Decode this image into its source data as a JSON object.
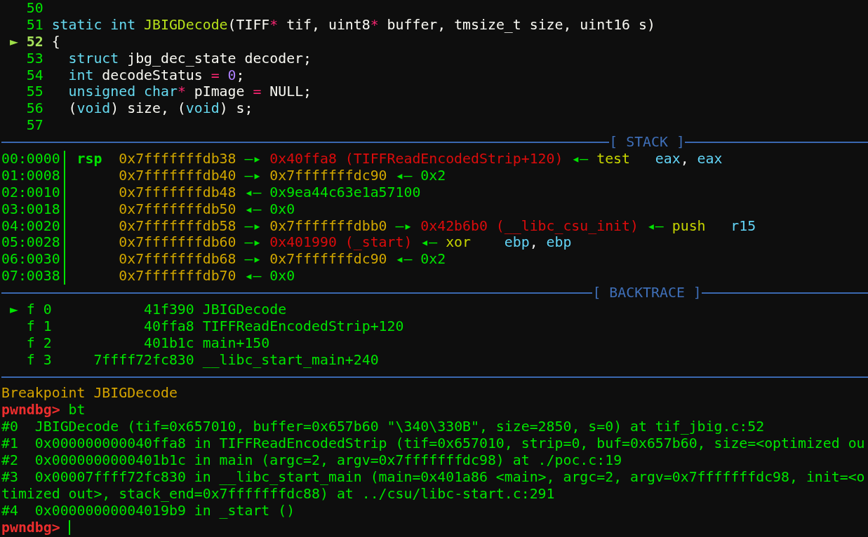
{
  "source": {
    "marker": "►",
    "lines": [
      {
        "number": "50",
        "current": false
      },
      {
        "number": "51",
        "current": false,
        "code": [
          {
            "kind": "keyword",
            "text": "static int "
          },
          {
            "kind": "function",
            "text": "JBIGDecode"
          },
          {
            "kind": "plain",
            "text": "(TIFF"
          },
          {
            "kind": "operator",
            "text": "*"
          },
          {
            "kind": "plain",
            "text": " tif, uint8"
          },
          {
            "kind": "operator",
            "text": "*"
          },
          {
            "kind": "plain",
            "text": " buffer, tmsize_t size, uint16 s)"
          }
        ]
      },
      {
        "number": "52",
        "current": true,
        "code": [
          {
            "kind": "plain",
            "text": "{"
          }
        ]
      },
      {
        "number": "53",
        "current": false,
        "code": [
          {
            "kind": "keyword",
            "text": "  struct"
          },
          {
            "kind": "plain",
            "text": " jbg_dec_state decoder;"
          }
        ]
      },
      {
        "number": "54",
        "current": false,
        "code": [
          {
            "kind": "keyword",
            "text": "  int"
          },
          {
            "kind": "plain",
            "text": " decodeStatus "
          },
          {
            "kind": "operator",
            "text": "="
          },
          {
            "kind": "number",
            "text": " 0"
          },
          {
            "kind": "plain",
            "text": ";"
          }
        ]
      },
      {
        "number": "55",
        "current": false,
        "code": [
          {
            "kind": "keyword",
            "text": "  unsigned char"
          },
          {
            "kind": "operator",
            "text": "*"
          },
          {
            "kind": "plain",
            "text": " pImage "
          },
          {
            "kind": "operator",
            "text": "="
          },
          {
            "kind": "plain",
            "text": " NULL;"
          }
        ]
      },
      {
        "number": "56",
        "current": false,
        "code": [
          {
            "kind": "plain",
            "text": "  ("
          },
          {
            "kind": "keyword",
            "text": "void"
          },
          {
            "kind": "plain",
            "text": ") size, ("
          },
          {
            "kind": "keyword",
            "text": "void"
          },
          {
            "kind": "plain",
            "text": ") s;"
          }
        ]
      },
      {
        "number": "57",
        "current": false
      }
    ]
  },
  "stack": {
    "title": "[ STACK ]",
    "entries": [
      {
        "offset": "00:0000",
        "register": "rsp",
        "chain": [
          {
            "kind": "stack",
            "text": "0x7fffffffdb38"
          },
          {
            "kind": "arrow",
            "text": "—▸"
          },
          {
            "kind": "code",
            "text": "0x40ffa8 (TIFFReadEncodedStrip+120)"
          },
          {
            "kind": "arrow",
            "text": "◂—"
          },
          {
            "kind": "mnemonic",
            "text": "test"
          },
          {
            "kind": "operand",
            "text": "eax"
          },
          {
            "kind": "punct",
            "text": ","
          },
          {
            "kind": "operand",
            "text": "eax"
          }
        ]
      },
      {
        "offset": "01:0008",
        "chain": [
          {
            "kind": "stack",
            "text": "0x7fffffffdb40"
          },
          {
            "kind": "arrow",
            "text": "—▸"
          },
          {
            "kind": "stack",
            "text": "0x7fffffffdc90"
          },
          {
            "kind": "arrow",
            "text": "◂—"
          },
          {
            "kind": "data",
            "text": "0x2"
          }
        ]
      },
      {
        "offset": "02:0010",
        "chain": [
          {
            "kind": "stack",
            "text": "0x7fffffffdb48"
          },
          {
            "kind": "arrow",
            "text": "◂—"
          },
          {
            "kind": "data",
            "text": "0x9ea44c63e1a57100"
          }
        ]
      },
      {
        "offset": "03:0018",
        "chain": [
          {
            "kind": "stack",
            "text": "0x7fffffffdb50"
          },
          {
            "kind": "arrow",
            "text": "◂—"
          },
          {
            "kind": "data",
            "text": "0x0"
          }
        ]
      },
      {
        "offset": "04:0020",
        "chain": [
          {
            "kind": "stack",
            "text": "0x7fffffffdb58"
          },
          {
            "kind": "arrow",
            "text": "—▸"
          },
          {
            "kind": "stack",
            "text": "0x7fffffffdbb0"
          },
          {
            "kind": "arrow",
            "text": "—▸"
          },
          {
            "kind": "code",
            "text": "0x42b6b0 (__libc_csu_init)"
          },
          {
            "kind": "arrow",
            "text": "◂—"
          },
          {
            "kind": "mnemonic",
            "text": "push"
          },
          {
            "kind": "operand",
            "text": "r15"
          }
        ]
      },
      {
        "offset": "05:0028",
        "chain": [
          {
            "kind": "stack",
            "text": "0x7fffffffdb60"
          },
          {
            "kind": "arrow",
            "text": "—▸"
          },
          {
            "kind": "code",
            "text": "0x401990 (_start)"
          },
          {
            "kind": "arrow",
            "text": "◂—"
          },
          {
            "kind": "mnemonic",
            "text": "xor"
          },
          {
            "kind": "operand",
            "text": "ebp"
          },
          {
            "kind": "punct",
            "text": ","
          },
          {
            "kind": "operand",
            "text": "ebp"
          }
        ]
      },
      {
        "offset": "06:0030",
        "chain": [
          {
            "kind": "stack",
            "text": "0x7fffffffdb68"
          },
          {
            "kind": "arrow",
            "text": "—▸"
          },
          {
            "kind": "stack",
            "text": "0x7fffffffdc90"
          },
          {
            "kind": "arrow",
            "text": "◂—"
          },
          {
            "kind": "data",
            "text": "0x2"
          }
        ]
      },
      {
        "offset": "07:0038",
        "chain": [
          {
            "kind": "stack",
            "text": "0x7fffffffdb70"
          },
          {
            "kind": "arrow",
            "text": "◂—"
          },
          {
            "kind": "data",
            "text": "0x0"
          }
        ]
      }
    ]
  },
  "backtrace": {
    "title": "[ BACKTRACE ]",
    "marker": "►",
    "frames": [
      {
        "selected": true,
        "index": "f 0",
        "address": "41f390",
        "symbol": "JBIGDecode"
      },
      {
        "selected": false,
        "index": "f 1",
        "address": "40ffa8",
        "symbol": "TIFFReadEncodedStrip+120"
      },
      {
        "selected": false,
        "index": "f 2",
        "address": "401b1c",
        "symbol": "main+150"
      },
      {
        "selected": false,
        "index": "f 3",
        "address": "7ffff72fc830",
        "symbol": "__libc_start_main+240"
      }
    ]
  },
  "console": {
    "lines": [
      {
        "kind": "info",
        "text": "Breakpoint JBIGDecode"
      },
      {
        "kind": "command",
        "prompt": "pwndbg>",
        "text": "bt",
        "cursor": false
      },
      {
        "kind": "output",
        "text": "#0  JBIGDecode (tif=0x657010, buffer=0x657b60 \"\\340\\330B\", size=2850, s=0) at tif_jbig.c:52"
      },
      {
        "kind": "output",
        "text": "#1  0x000000000040ffa8 in TIFFReadEncodedStrip (tif=0x657010, strip=0, buf=0x657b60, size=<optimized ou"
      },
      {
        "kind": "output",
        "text": "#2  0x0000000000401b1c in main (argc=2, argv=0x7fffffffdc98) at ./poc.c:19"
      },
      {
        "kind": "output",
        "text": "#3  0x00007ffff72fc830 in __libc_start_main (main=0x401a86 <main>, argc=2, argv=0x7fffffffdc98, init=<o"
      },
      {
        "kind": "output",
        "text": "timized out>, stack_end=0x7fffffffdc88) at ../csu/libc-start.c:291"
      },
      {
        "kind": "output",
        "text": "#4  0x00000000004019b9 in _start ()"
      },
      {
        "kind": "command",
        "prompt": "pwndbg>",
        "cursor": true
      }
    ]
  }
}
